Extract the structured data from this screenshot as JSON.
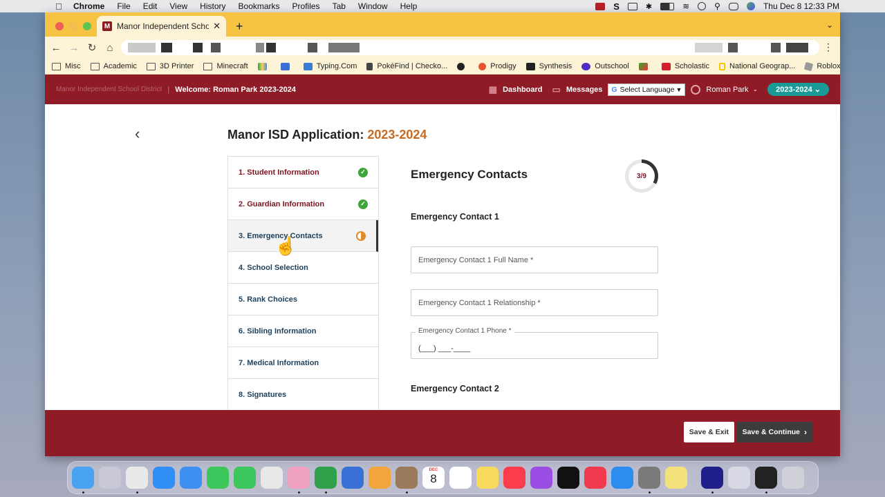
{
  "menubar": {
    "app": "Chrome",
    "items": [
      "File",
      "Edit",
      "View",
      "History",
      "Bookmarks",
      "Profiles",
      "Tab",
      "Window",
      "Help"
    ],
    "clock": "Thu Dec 8  12:33 PM"
  },
  "browser": {
    "tab_title": "Manor Independent School Dis",
    "tab_favicon": "M",
    "bookmarks": [
      {
        "label": "Misc",
        "icon": "folder-icon"
      },
      {
        "label": "Academic",
        "icon": "folder-icon"
      },
      {
        "label": "3D Printer",
        "icon": "folder-icon"
      },
      {
        "label": "Minecraft",
        "icon": "folder-icon"
      },
      {
        "label": "",
        "icon": "google-drive-icon"
      },
      {
        "label": "",
        "icon": "meet-icon"
      },
      {
        "label": "Typing.Com",
        "icon": "typing-icon"
      },
      {
        "label": "PokéFind | Checko...",
        "icon": "pokefind-icon"
      },
      {
        "label": "",
        "icon": "github-icon"
      },
      {
        "label": "Prodigy",
        "icon": "prodigy-icon"
      },
      {
        "label": "Synthesis",
        "icon": "synthesis-icon"
      },
      {
        "label": "Outschool",
        "icon": "outschool-icon"
      },
      {
        "label": "",
        "icon": "game-icon"
      },
      {
        "label": "Scholastic",
        "icon": "scholastic-icon"
      },
      {
        "label": "National Geograp...",
        "icon": "natgeo-icon"
      },
      {
        "label": "Roblox",
        "icon": "roblox-icon"
      }
    ]
  },
  "site_header": {
    "district": "Manor Independent School District",
    "welcome": "Welcome: Roman Park 2023-2024",
    "dashboard": "Dashboard",
    "messages": "Messages",
    "language": "Select Language",
    "user": "Roman Park",
    "year": "2023-2024"
  },
  "page": {
    "title_prefix": "Manor ISD Application:",
    "title_year": "2023-2024",
    "steps": [
      {
        "label": "1. Student Information",
        "status": "complete"
      },
      {
        "label": "2. Guardian Information",
        "status": "complete"
      },
      {
        "label": "3. Emergency Contacts",
        "status": "in-progress"
      },
      {
        "label": "4. School Selection",
        "status": "pending"
      },
      {
        "label": "5. Rank Choices",
        "status": "pending"
      },
      {
        "label": "6. Sibling Information",
        "status": "pending"
      },
      {
        "label": "7. Medical Information",
        "status": "pending"
      },
      {
        "label": "8. Signatures",
        "status": "pending"
      }
    ],
    "form_title": "Emergency Contacts",
    "progress": "3/9",
    "progress_fraction": 0.33,
    "contact1_heading": "Emergency Contact 1",
    "contact1_name_placeholder": "Emergency Contact 1 Full Name *",
    "contact1_relationship_placeholder": "Emergency Contact 1 Relationship *",
    "contact1_phone_label": "Emergency Contact 1 Phone *",
    "contact1_phone_mask": "(___) ___-____",
    "contact2_heading": "Emergency Contact 2"
  },
  "footer": {
    "save_exit": "Save & Exit",
    "save_continue": "Save & Continue"
  },
  "colors": {
    "brand_maroon": "#8f1b27",
    "accent_teal": "#1a9a97",
    "year_orange": "#c46a22",
    "complete_green": "#3ea53a",
    "in_progress_orange": "#e18a2a"
  },
  "dock": {
    "calendar_month": "DEC",
    "calendar_day": "8",
    "apps": [
      "finder-icon",
      "launchpad-icon",
      "chrome-icon",
      "safari-icon",
      "mail-icon",
      "facetime-icon",
      "messages-icon",
      "maps-icon",
      "photos-icon",
      "classroom-icon",
      "scratch-icon",
      "keynote-icon",
      "contacts-icon",
      "calendar-icon",
      "reminders-icon",
      "notes-icon",
      "music-icon",
      "podcasts-icon",
      "tv-icon",
      "news-icon",
      "appstore-icon",
      "settings-icon",
      "stickies-icon",
      "webex-icon",
      "preview-icon",
      "terminal-icon",
      "trash-icon"
    ]
  }
}
